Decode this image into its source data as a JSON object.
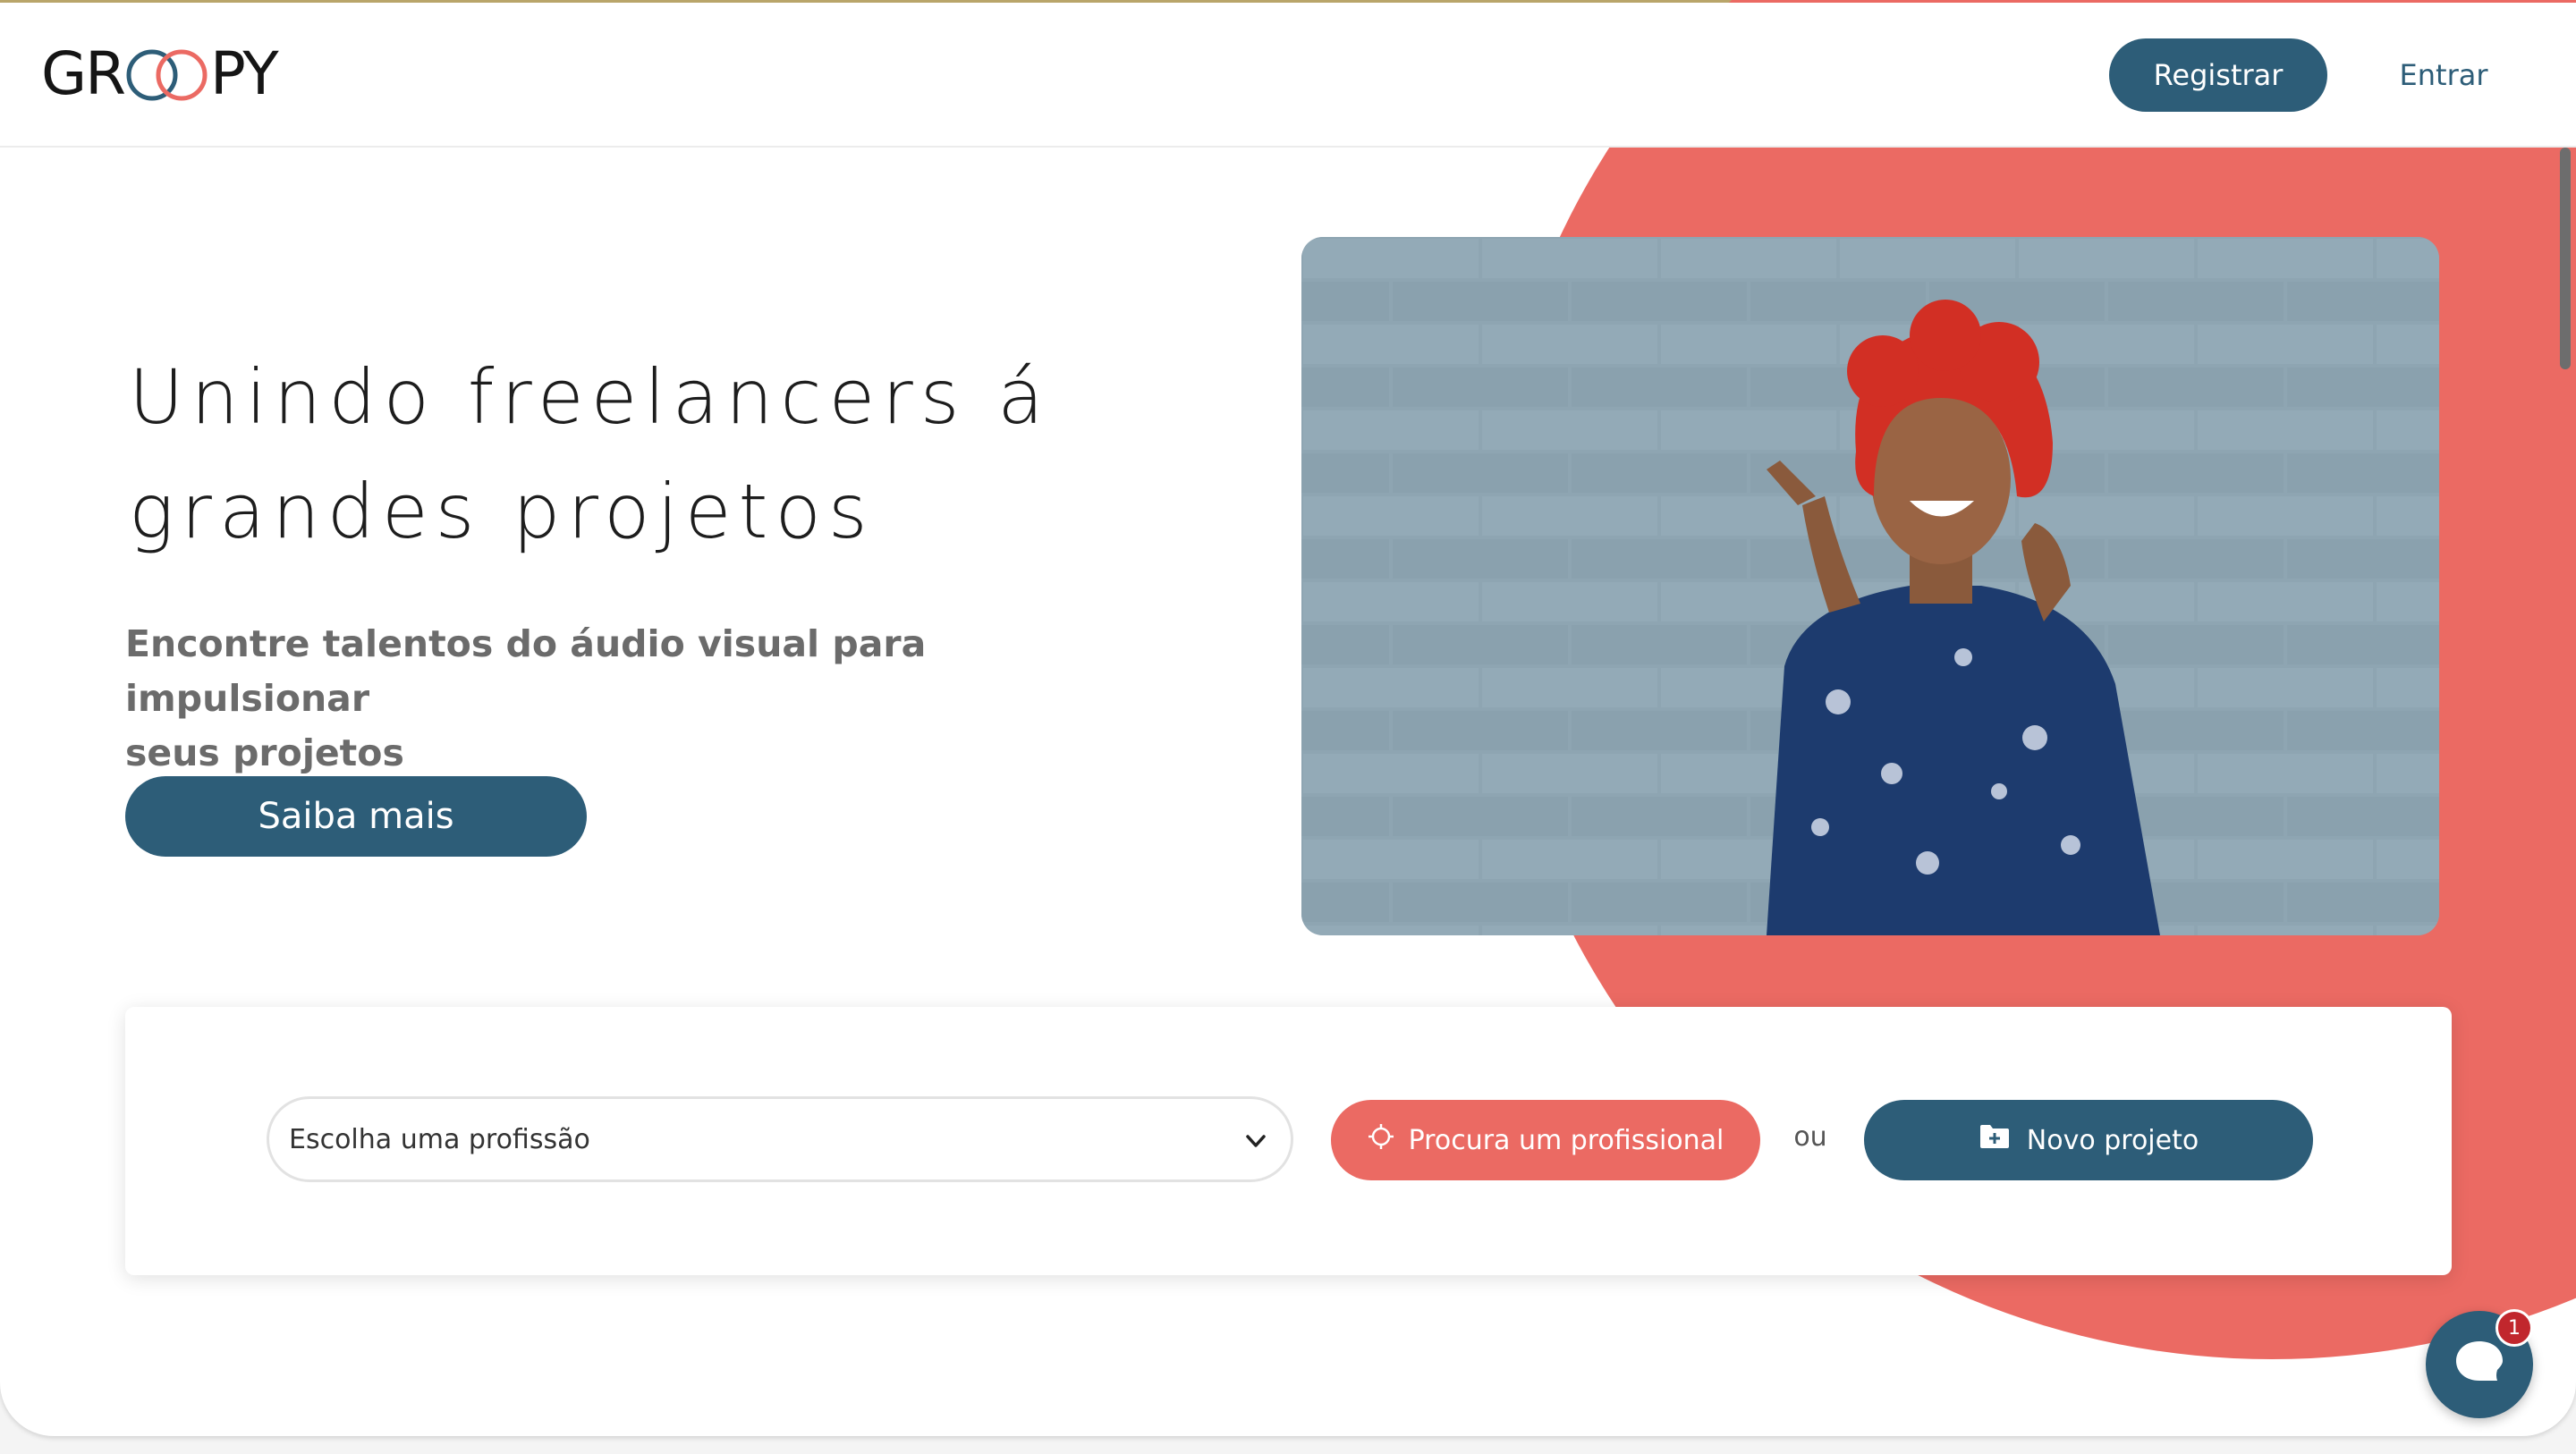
{
  "brand": {
    "name_left": "GR",
    "name_right": "PY",
    "ring_colors": [
      "#2d5d78",
      "#eb6a63"
    ]
  },
  "header": {
    "register_label": "Registrar",
    "login_label": "Entrar"
  },
  "hero": {
    "title_line1": "Unindo freelancers á",
    "title_line2": "grandes projetos",
    "subtitle_line1": "Encontre talentos do áudio visual para impulsionar",
    "subtitle_line2": "seus projetos",
    "cta_label": "Saiba mais"
  },
  "search": {
    "profession_select": "Escolha uma profissão",
    "find_button": "Procura um profissional",
    "or_text": "ou",
    "new_project_button": "Novo projeto"
  },
  "chat": {
    "badge_count": "1"
  },
  "colors": {
    "primary": "#2d5d78",
    "accent": "#eb6a63"
  },
  "icons": {
    "select": "chevron-down-icon",
    "find": "crosshair-icon",
    "new_project": "folder-plus-icon",
    "chat": "chat-bubble-icon"
  }
}
